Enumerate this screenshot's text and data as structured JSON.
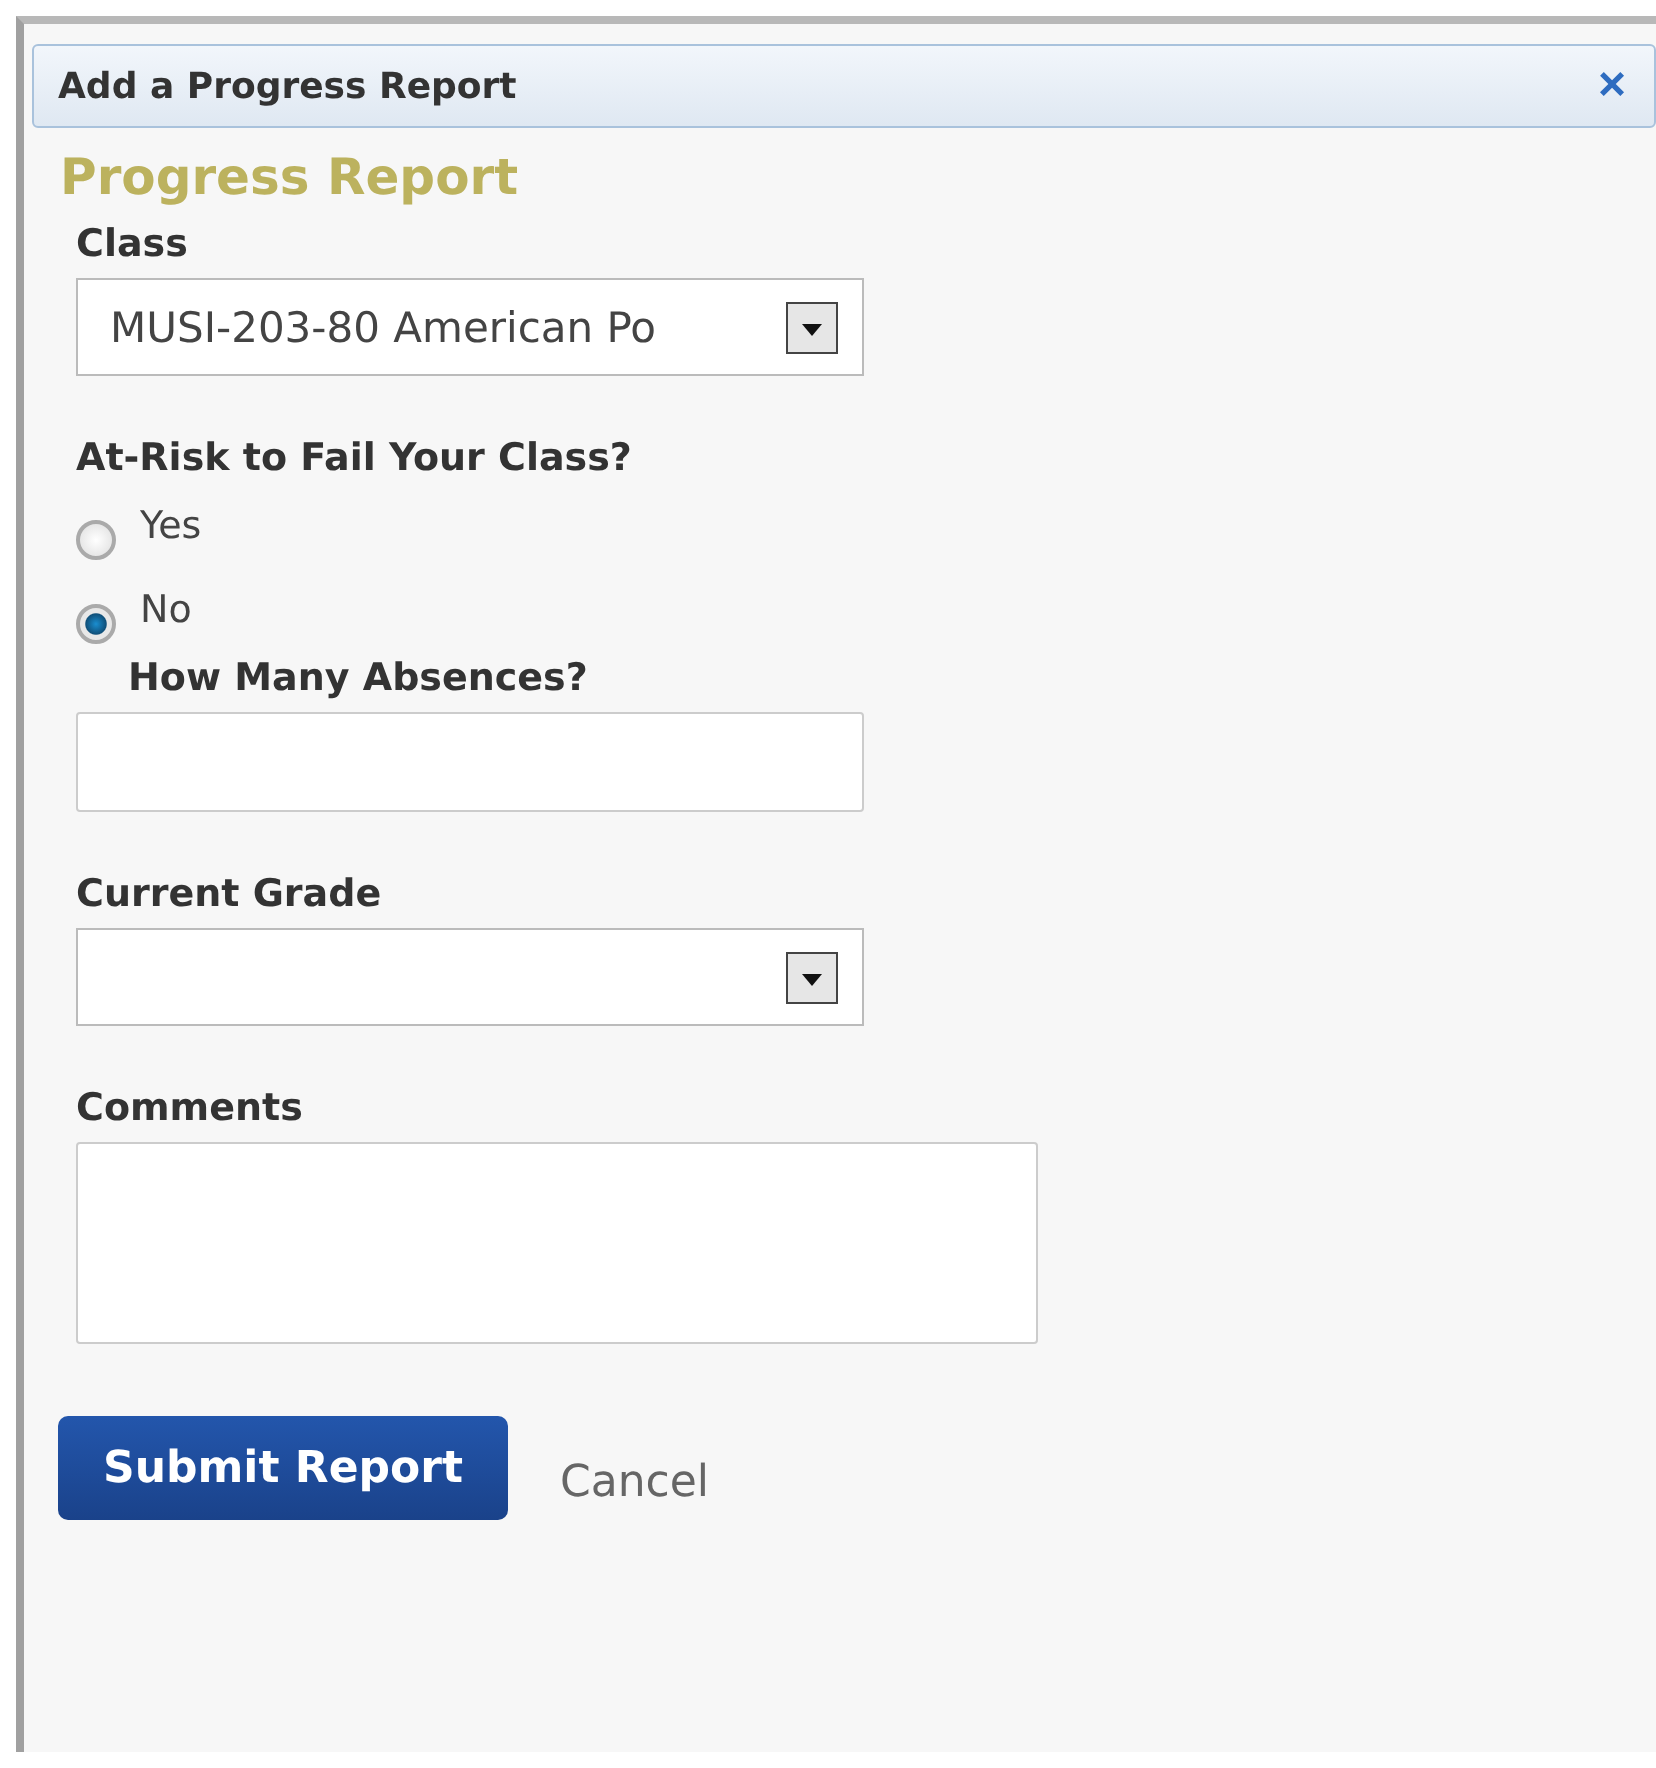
{
  "dialog": {
    "title": "Add a Progress Report",
    "close": "×"
  },
  "heading": "Progress Report",
  "class_field": {
    "label": "Class",
    "value": "MUSI-203-80 American Po"
  },
  "at_risk": {
    "label": "At-Risk to Fail Your Class?",
    "options": [
      {
        "label": "Yes",
        "selected": false
      },
      {
        "label": "No",
        "selected": true
      }
    ]
  },
  "absences": {
    "label": "How Many Absences?"
  },
  "grade": {
    "label": "Current Grade"
  },
  "comments": {
    "label": "Comments"
  },
  "buttons": {
    "submit": "Submit Report",
    "cancel": "Cancel"
  }
}
